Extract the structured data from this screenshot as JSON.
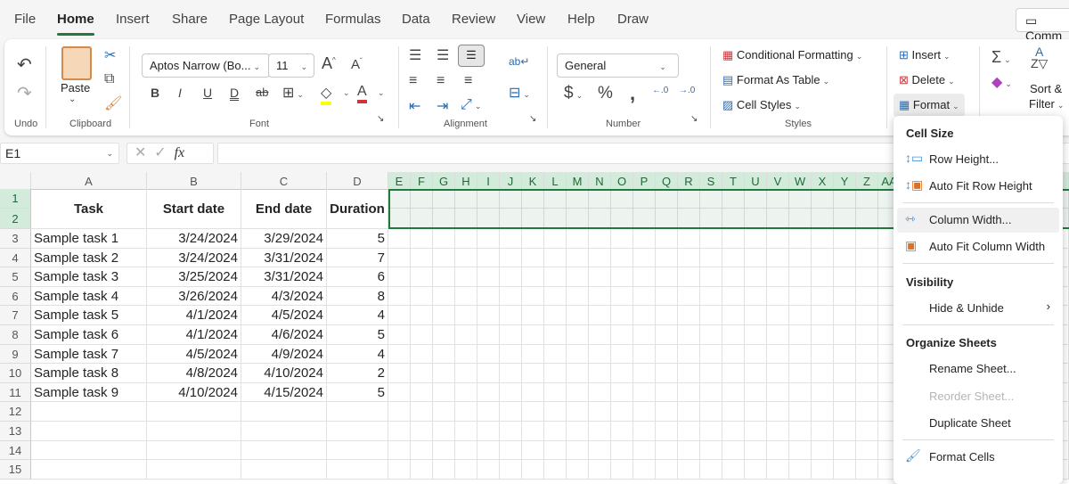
{
  "menu_tabs": [
    "File",
    "Home",
    "Insert",
    "Share",
    "Page Layout",
    "Formulas",
    "Data",
    "Review",
    "View",
    "Help",
    "Draw"
  ],
  "active_tab": "Home",
  "comments_label": "Comm",
  "ribbon": {
    "undo_group": "Undo",
    "clipboard_group": "Clipboard",
    "paste": "Paste",
    "font_group": "Font",
    "font_name": "Aptos Narrow (Bo...",
    "font_size": "11",
    "alignment_group": "Alignment",
    "number_group": "Number",
    "number_format": "General",
    "styles_group": "Styles",
    "conditional_formatting": "Conditional Formatting",
    "format_as_table": "Format As Table",
    "cell_styles": "Cell Styles",
    "insert": "Insert",
    "delete": "Delete",
    "format": "Format",
    "sort_filter_1": "Sort &",
    "sort_filter_2": "Filter",
    "font_color": "#d13438",
    "highlight_color": "#ffff00"
  },
  "formula_bar": {
    "name_box": "E1",
    "fx": "fx",
    "value": ""
  },
  "sheet": {
    "columns": [
      "A",
      "B",
      "C",
      "D",
      "E",
      "F",
      "G",
      "H",
      "I",
      "J",
      "K",
      "L",
      "M",
      "N",
      "O",
      "P",
      "Q",
      "R",
      "S",
      "T",
      "U",
      "V",
      "W",
      "X",
      "Y",
      "Z",
      "AA"
    ],
    "headers": [
      "Task",
      "Start date",
      "End date",
      "Duration"
    ],
    "rows": [
      [
        "Sample task 1",
        "3/24/2024",
        "3/29/2024",
        "5"
      ],
      [
        "Sample task 2",
        "3/24/2024",
        "3/31/2024",
        "7"
      ],
      [
        "Sample task 3",
        "3/25/2024",
        "3/31/2024",
        "6"
      ],
      [
        "Sample task 4",
        "3/26/2024",
        "4/3/2024",
        "8"
      ],
      [
        "Sample task 5",
        "4/1/2024",
        "4/5/2024",
        "4"
      ],
      [
        "Sample task 6",
        "4/1/2024",
        "4/6/2024",
        "5"
      ],
      [
        "Sample task 7",
        "4/5/2024",
        "4/9/2024",
        "4"
      ],
      [
        "Sample task 8",
        "4/8/2024",
        "4/10/2024",
        "2"
      ],
      [
        "Sample task 9",
        "4/10/2024",
        "4/15/2024",
        "5"
      ]
    ],
    "row_numbers": [
      "1",
      "2",
      "3",
      "4",
      "5",
      "6",
      "7",
      "8",
      "9",
      "10",
      "11",
      "12",
      "13",
      "14",
      "15"
    ],
    "selected_range": "E1:AA2"
  },
  "format_menu": {
    "cell_size": "Cell Size",
    "row_height": "Row Height...",
    "auto_fit_row": "Auto Fit Row Height",
    "column_width": "Column Width...",
    "auto_fit_column": "Auto Fit Column Width",
    "visibility": "Visibility",
    "hide_unhide": "Hide & Unhide",
    "organize": "Organize Sheets",
    "rename": "Rename Sheet...",
    "reorder": "Reorder Sheet...",
    "duplicate": "Duplicate Sheet",
    "format_cells": "Format Cells"
  }
}
